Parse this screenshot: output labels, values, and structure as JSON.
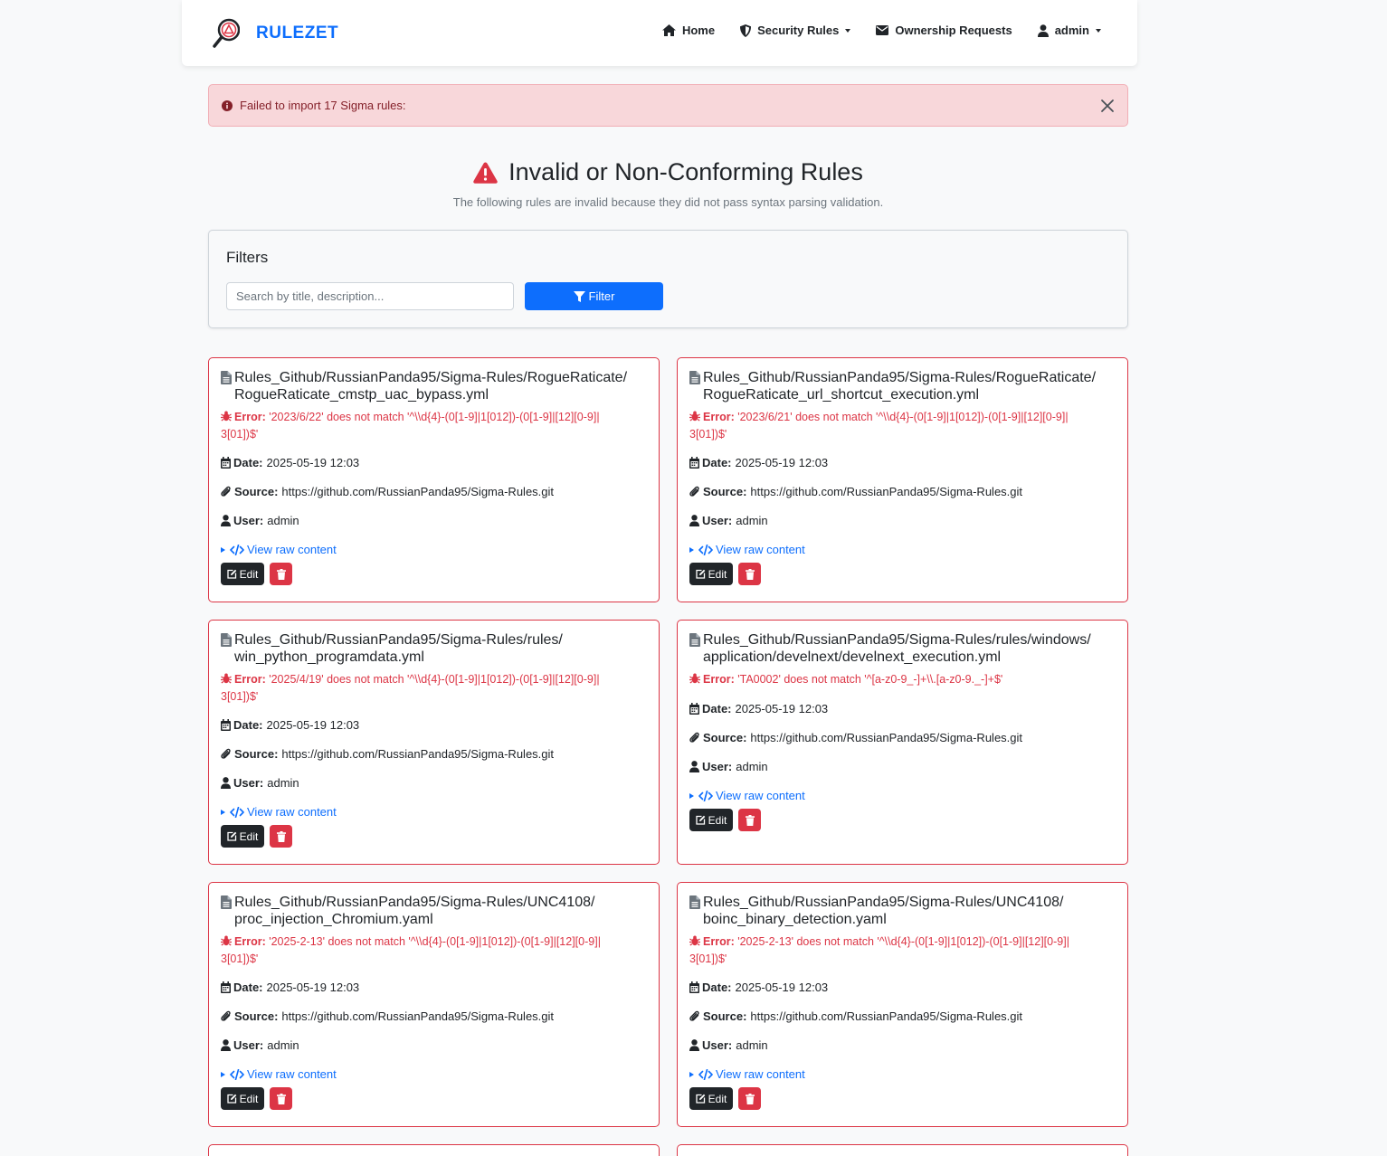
{
  "nav": {
    "brand": "RULEZET",
    "items": [
      {
        "label": "Home",
        "icon": "home-icon"
      },
      {
        "label": "Security Rules",
        "icon": "shield-icon"
      },
      {
        "label": "Ownership Requests",
        "icon": "envelope-icon"
      },
      {
        "label": "admin",
        "icon": "user-icon"
      }
    ]
  },
  "alert": {
    "message": "Failed to import 17 Sigma rules:"
  },
  "header": {
    "title": "Invalid or Non-Conforming Rules",
    "subtitle": "The following rules are invalid because they did not pass syntax parsing validation."
  },
  "filters": {
    "title": "Filters",
    "search_placeholder": "Search by title, description...",
    "search_value": "",
    "button_label": "Filter"
  },
  "labels": {
    "error": "Error:",
    "date": "Date:",
    "source": "Source:",
    "user": "User:",
    "view_raw": "View raw content",
    "edit": "Edit"
  },
  "colors": {
    "accent": "#0d6efd",
    "danger": "#dc3545",
    "dark": "#212529"
  },
  "rules": [
    {
      "title_line1": "Rules_Github/RussianPanda95/Sigma-Rules/RogueRaticate/",
      "title_line2": "RogueRaticate_cmstp_uac_bypass.yml",
      "error_line1": "'2023/6/22' does not match '^\\\\d{4}-(0[1-9]|1[012])-(0[1-9]|[12][0-9]|",
      "error_line2": "3[01])$'",
      "date": "2025-05-19 12:03",
      "source": "https://github.com/RussianPanda95/Sigma-Rules.git",
      "user": "admin"
    },
    {
      "title_line1": "Rules_Github/RussianPanda95/Sigma-Rules/RogueRaticate/",
      "title_line2": "RogueRaticate_url_shortcut_execution.yml",
      "error_line1": "'2023/6/21' does not match '^\\\\d{4}-(0[1-9]|1[012])-(0[1-9]|[12][0-9]|",
      "error_line2": "3[01])$'",
      "date": "2025-05-19 12:03",
      "source": "https://github.com/RussianPanda95/Sigma-Rules.git",
      "user": "admin"
    },
    {
      "title_line1": "Rules_Github/RussianPanda95/Sigma-Rules/rules/",
      "title_line2": "win_python_programdata.yml",
      "error_line1": "'2025/4/19' does not match '^\\\\d{4}-(0[1-9]|1[012])-(0[1-9]|[12][0-9]|",
      "error_line2": "3[01])$'",
      "date": "2025-05-19 12:03",
      "source": "https://github.com/RussianPanda95/Sigma-Rules.git",
      "user": "admin"
    },
    {
      "title_line1": "Rules_Github/RussianPanda95/Sigma-Rules/rules/windows/",
      "title_line2": "application/develnext/develnext_execution.yml",
      "error_line1": "'TA0002' does not match '^[a-z0-9_-]+\\\\.[a-z0-9._-]+$'",
      "error_line2": "",
      "date": "2025-05-19 12:03",
      "source": "https://github.com/RussianPanda95/Sigma-Rules.git",
      "user": "admin"
    },
    {
      "title_line1": "Rules_Github/RussianPanda95/Sigma-Rules/UNC4108/",
      "title_line2": "proc_injection_Chromium.yaml",
      "error_line1": "'2025-2-13' does not match '^\\\\d{4}-(0[1-9]|1[012])-(0[1-9]|[12][0-9]|",
      "error_line2": "3[01])$'",
      "date": "2025-05-19 12:03",
      "source": "https://github.com/RussianPanda95/Sigma-Rules.git",
      "user": "admin"
    },
    {
      "title_line1": "Rules_Github/RussianPanda95/Sigma-Rules/UNC4108/",
      "title_line2": "boinc_binary_detection.yaml",
      "error_line1": "'2025-2-13' does not match '^\\\\d{4}-(0[1-9]|1[012])-(0[1-9]|[12][0-9]|",
      "error_line2": "3[01])$'",
      "date": "2025-05-19 12:03",
      "source": "https://github.com/RussianPanda95/Sigma-Rules.git",
      "user": "admin"
    }
  ]
}
